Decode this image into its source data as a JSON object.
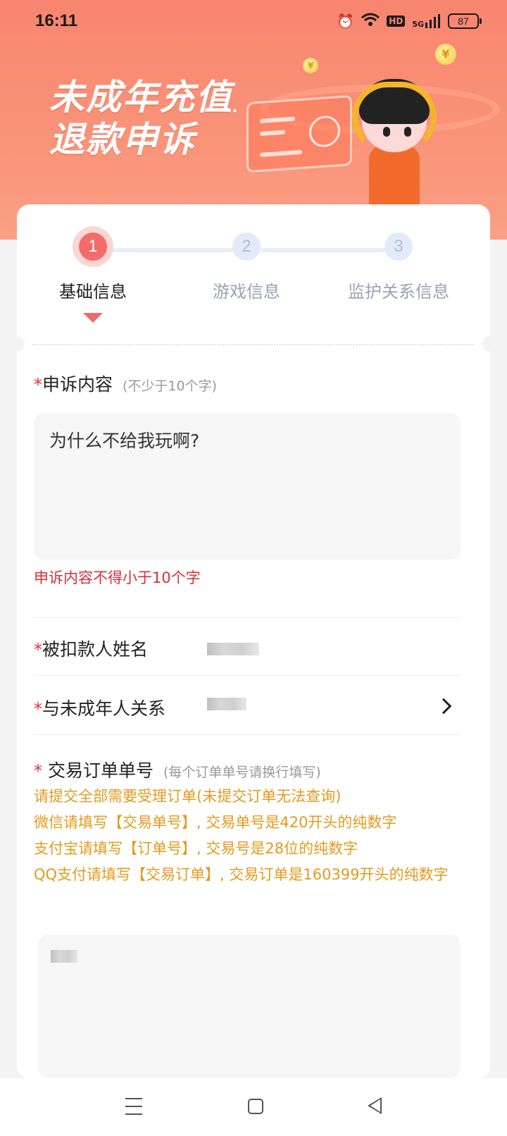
{
  "status_bar": {
    "time": "16:11",
    "hd_label": "HD",
    "network_label": "5G",
    "battery": "87"
  },
  "banner": {
    "title_line1": "未成年充值",
    "title_line2": "退款申诉",
    "coin_symbol": "¥"
  },
  "steps": [
    {
      "number": "1",
      "label": "基础信息",
      "active": true
    },
    {
      "number": "2",
      "label": "游戏信息",
      "active": false
    },
    {
      "number": "3",
      "label": "监护关系信息",
      "active": false
    }
  ],
  "appeal": {
    "required_mark": "*",
    "title": "申诉内容",
    "hint": "(不少于10个字)",
    "value": "为什么不给我玩啊?",
    "error": "申诉内容不得小于10个字"
  },
  "payer": {
    "required_mark": "*",
    "label": "被扣款人姓名"
  },
  "relation": {
    "required_mark": "*",
    "label": "与未成年人关系"
  },
  "orders": {
    "required_mark": "*",
    "title": "交易订单单号",
    "hint": "(每个订单单号请换行填写)",
    "notes": [
      "请提交全部需要受理订单(未提交订单无法查询)",
      "微信请填写【交易单号】, 交易单号是420开头的纯数字",
      "支付宝请填写【订单号】, 交易号是28位的纯数字",
      "QQ支付请填写【交易订单】, 交易订单是160399开头的纯数字"
    ]
  },
  "colors": {
    "accent": "#f36b6b",
    "error": "#d9303a",
    "note": "#e39a1e",
    "banner": "#f7856f"
  },
  "icons": {
    "alarm": "alarm-icon",
    "wifi": "wifi-icon",
    "signal": "signal-icon",
    "battery": "battery-icon",
    "chevron": "chevron-right-icon",
    "nav_menu": "menu-icon",
    "nav_home": "home-icon",
    "nav_back": "back-icon"
  }
}
